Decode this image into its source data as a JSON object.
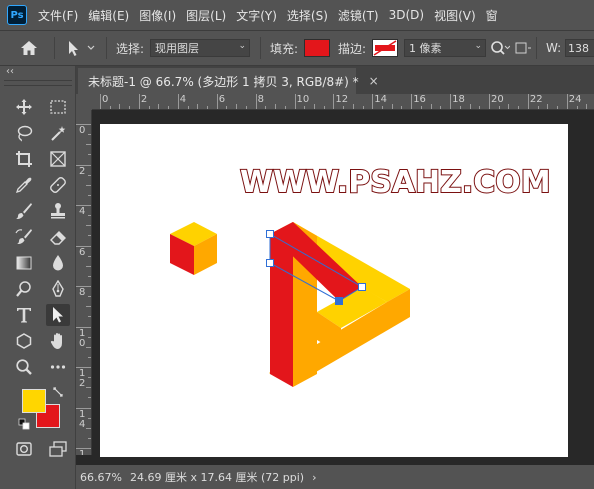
{
  "menu": {
    "logo": "Ps",
    "items": [
      "文件(F)",
      "编辑(E)",
      "图像(I)",
      "图层(L)",
      "文字(Y)",
      "选择(S)",
      "滤镜(T)",
      "3D(D)",
      "视图(V)",
      "窗"
    ]
  },
  "options": {
    "select_label": "选择:",
    "select_value": "现用图层",
    "fill_label": "填充:",
    "fill_color": "#e3161b",
    "stroke_label": "描边:",
    "stroke_width": "1 像素",
    "width_label": "W:",
    "width_value": "138"
  },
  "toolbar": {
    "collapse": "‹‹",
    "foreground_color": "#ffd600",
    "background_color": "#e3161b"
  },
  "document": {
    "tab_title": "未标题-1 @ 66.7% (多边形 1 拷贝 3, RGB/8#) *",
    "tab_close": "×",
    "hruler_labels": [
      "0",
      "2",
      "4",
      "6",
      "8",
      "10",
      "12",
      "14",
      "16",
      "18",
      "20",
      "22",
      "24"
    ],
    "vruler_labels": [
      "0",
      "2",
      "4",
      "6",
      "8",
      "10",
      "12",
      "14",
      "16"
    ],
    "watermark": "WWW.PSAHZ.COM",
    "colors": {
      "yellow": "#ffd200",
      "orange": "#ffa800",
      "red": "#e3161b",
      "canvas": "#ffffff",
      "watermark_stroke": "#7a1010"
    }
  },
  "status": {
    "zoom": "66.67%",
    "doc_size": "24.69 厘米 x 17.64 厘米 (72 ppi)",
    "arrow": "›"
  }
}
